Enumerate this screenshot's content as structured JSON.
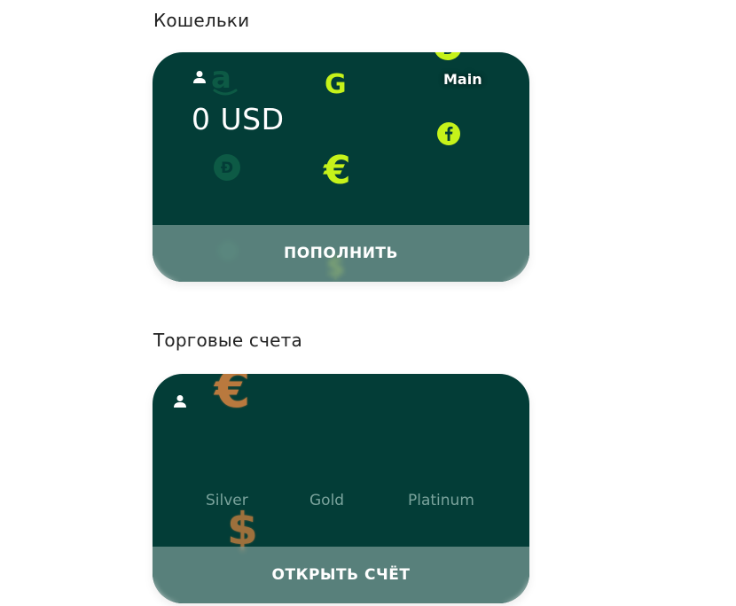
{
  "wallets_section": {
    "title": "Кошельки",
    "card": {
      "balance": "0 USD",
      "badge": "Main",
      "action_label": "ПОПОЛНИТЬ"
    }
  },
  "trading_section": {
    "title": "Торговые счета",
    "card": {
      "tiers": [
        "Silver",
        "Gold",
        "Platinum"
      ],
      "action_label": "ОТКРЫТЬ СЧЁТ"
    }
  },
  "theme": {
    "card_bg": "#033d37",
    "accent_lime": "#c6f21a",
    "accent_bronze": "#b9793e",
    "footer_overlay": "#8caaa4"
  },
  "icons": {
    "user": "user-icon",
    "amazon": "amazon-icon",
    "google": "google-icon",
    "facebook": "facebook-icon",
    "euro": "euro-icon",
    "dollar": "dollar-icon",
    "dogecoin": "dogecoin-icon",
    "bitcoin": "bitcoin-icon"
  }
}
